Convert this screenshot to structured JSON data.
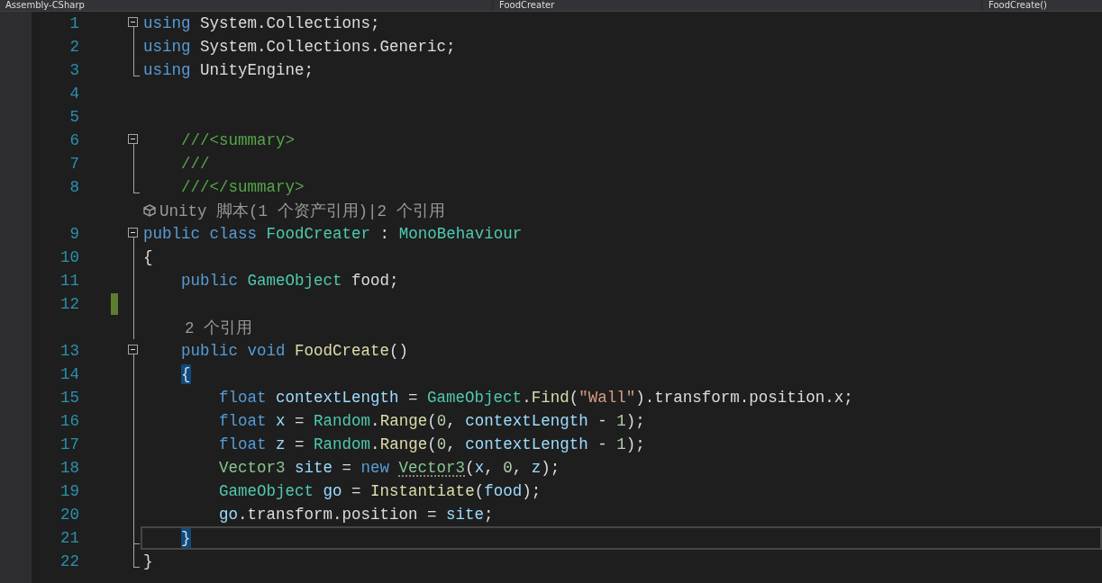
{
  "navigation_bar": [
    {
      "label": "Assembly-CSharp"
    },
    {
      "label": "FoodCreater"
    },
    {
      "label": "FoodCreate()"
    }
  ],
  "editor": {
    "rows": [
      {
        "kind": "line",
        "number": "1",
        "expanded": true,
        "tokens": [
          {
            "kind": "kw",
            "text": "using"
          },
          {
            "kind": "plain",
            "text": " System.Collections;"
          }
        ]
      },
      {
        "kind": "line",
        "number": "2",
        "tokens": [
          {
            "kind": "kw",
            "text": "using"
          },
          {
            "kind": "plain",
            "text": " System.Collections.Generic;"
          }
        ]
      },
      {
        "kind": "line",
        "number": "3",
        "region_end": true,
        "tokens": [
          {
            "kind": "kw",
            "text": "using"
          },
          {
            "kind": "plain",
            "text": " UnityEngine;"
          }
        ]
      },
      {
        "kind": "line",
        "number": "4",
        "tokens": []
      },
      {
        "kind": "line",
        "number": "5",
        "tokens": []
      },
      {
        "kind": "line",
        "number": "6",
        "expanded": true,
        "tokens": [
          {
            "kind": "comment",
            "text": "    ///<summary>"
          }
        ]
      },
      {
        "kind": "line",
        "number": "7",
        "tokens": [
          {
            "kind": "comment",
            "text": "    ///"
          }
        ]
      },
      {
        "kind": "line",
        "number": "8",
        "region_end": true,
        "tokens": [
          {
            "kind": "comment",
            "text": "    ///</summary>"
          }
        ]
      },
      {
        "kind": "lens",
        "icon": true,
        "text": "Unity 脚本(1 个资产引用)|2 个引用"
      },
      {
        "kind": "line",
        "number": "9",
        "expanded": true,
        "tokens": [
          {
            "kind": "kw",
            "text": "public"
          },
          {
            "kind": "kw",
            "text": " class"
          },
          {
            "kind": "type",
            "text": " FoodCreater"
          },
          {
            "kind": "plain",
            "text": " : "
          },
          {
            "kind": "type",
            "text": "MonoBehaviour"
          }
        ]
      },
      {
        "kind": "line",
        "number": "10",
        "tokens": [
          {
            "kind": "plain",
            "text": "{"
          }
        ]
      },
      {
        "kind": "line",
        "number": "11",
        "tokens": [
          {
            "kind": "kw",
            "text": "    public"
          },
          {
            "kind": "type",
            "text": " GameObject"
          },
          {
            "kind": "plain",
            "text": " food;"
          }
        ]
      },
      {
        "kind": "line",
        "number": "12",
        "changed": true,
        "tokens": []
      },
      {
        "kind": "lens",
        "icon": false,
        "text": "2 个引用"
      },
      {
        "kind": "line",
        "number": "13",
        "expanded": true,
        "tokens": [
          {
            "kind": "kw",
            "text": "    public"
          },
          {
            "kind": "kw",
            "text": " void"
          },
          {
            "kind": "fn",
            "text": " FoodCreate"
          },
          {
            "kind": "plain",
            "text": "()"
          }
        ]
      },
      {
        "kind": "line",
        "number": "14",
        "tokens": [
          {
            "kind": "brace",
            "text": "    {"
          }
        ]
      },
      {
        "kind": "line",
        "number": "15",
        "tokens": [
          {
            "kind": "kw",
            "text": "        float"
          },
          {
            "kind": "var",
            "text": " contextLength"
          },
          {
            "kind": "plain",
            "text": " = "
          },
          {
            "kind": "type",
            "text": "GameObject"
          },
          {
            "kind": "plain",
            "text": "."
          },
          {
            "kind": "fn",
            "text": "Find"
          },
          {
            "kind": "plain",
            "text": "("
          },
          {
            "kind": "str",
            "text": "\"Wall\""
          },
          {
            "kind": "plain",
            "text": ").transform.position.x;"
          }
        ]
      },
      {
        "kind": "line",
        "number": "16",
        "tokens": [
          {
            "kind": "kw",
            "text": "        float"
          },
          {
            "kind": "var",
            "text": " x"
          },
          {
            "kind": "plain",
            "text": " = "
          },
          {
            "kind": "type",
            "text": "Random"
          },
          {
            "kind": "plain",
            "text": "."
          },
          {
            "kind": "fn",
            "text": "Range"
          },
          {
            "kind": "plain",
            "text": "("
          },
          {
            "kind": "num",
            "text": "0"
          },
          {
            "kind": "plain",
            "text": ", "
          },
          {
            "kind": "var",
            "text": "contextLength"
          },
          {
            "kind": "plain",
            "text": " - "
          },
          {
            "kind": "num",
            "text": "1"
          },
          {
            "kind": "plain",
            "text": ");"
          }
        ]
      },
      {
        "kind": "line",
        "number": "17",
        "tokens": [
          {
            "kind": "kw",
            "text": "        float"
          },
          {
            "kind": "var",
            "text": " z"
          },
          {
            "kind": "plain",
            "text": " = "
          },
          {
            "kind": "type",
            "text": "Random"
          },
          {
            "kind": "plain",
            "text": "."
          },
          {
            "kind": "fn",
            "text": "Range"
          },
          {
            "kind": "plain",
            "text": "("
          },
          {
            "kind": "num",
            "text": "0"
          },
          {
            "kind": "plain",
            "text": ", "
          },
          {
            "kind": "var",
            "text": "contextLength"
          },
          {
            "kind": "plain",
            "text": " - "
          },
          {
            "kind": "num",
            "text": "1"
          },
          {
            "kind": "plain",
            "text": ");"
          }
        ]
      },
      {
        "kind": "line",
        "number": "18",
        "tokens": [
          {
            "kind": "struct",
            "text": "        Vector3"
          },
          {
            "kind": "var",
            "text": " site"
          },
          {
            "kind": "plain",
            "text": " = "
          },
          {
            "kind": "kw",
            "text": "new "
          },
          {
            "kind": "dotted",
            "text": "Vector3"
          },
          {
            "kind": "plain",
            "text": "("
          },
          {
            "kind": "var",
            "text": "x"
          },
          {
            "kind": "plain",
            "text": ", "
          },
          {
            "kind": "num",
            "text": "0"
          },
          {
            "kind": "plain",
            "text": ", "
          },
          {
            "kind": "var",
            "text": "z"
          },
          {
            "kind": "plain",
            "text": ");"
          }
        ]
      },
      {
        "kind": "line",
        "number": "19",
        "tokens": [
          {
            "kind": "type",
            "text": "        GameObject"
          },
          {
            "kind": "var",
            "text": " go"
          },
          {
            "kind": "plain",
            "text": " = "
          },
          {
            "kind": "fn",
            "text": "Instantiate"
          },
          {
            "kind": "plain",
            "text": "("
          },
          {
            "kind": "var",
            "text": "food"
          },
          {
            "kind": "plain",
            "text": ");"
          }
        ]
      },
      {
        "kind": "line",
        "number": "20",
        "tokens": [
          {
            "kind": "var",
            "text": "        go"
          },
          {
            "kind": "plain",
            "text": ".transform.position = "
          },
          {
            "kind": "var",
            "text": "site"
          },
          {
            "kind": "plain",
            "text": ";"
          }
        ]
      },
      {
        "kind": "line",
        "number": "21",
        "region_end": true,
        "current": true,
        "tokens": [
          {
            "kind": "brace",
            "text": "    }"
          }
        ]
      },
      {
        "kind": "line",
        "number": "22",
        "region_end": true,
        "tokens": [
          {
            "kind": "plain",
            "text": "}"
          }
        ]
      }
    ]
  }
}
